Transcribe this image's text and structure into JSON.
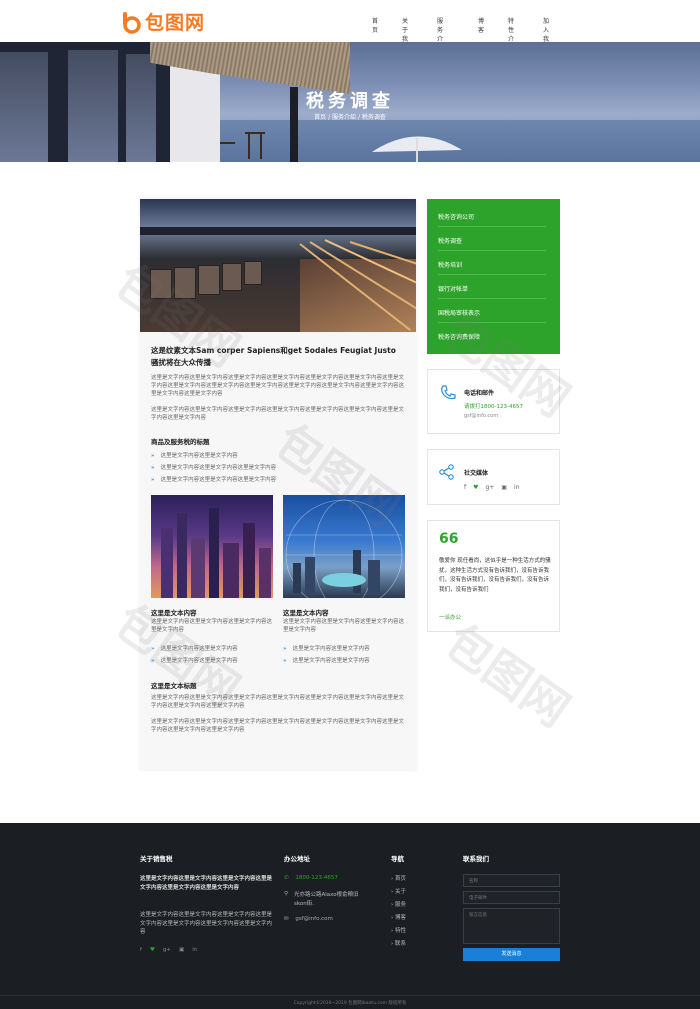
{
  "brand": {
    "name": "包图网",
    "accent": "#f47b20"
  },
  "nav": {
    "items": [
      {
        "label": "首页"
      },
      {
        "label": "关于我们"
      },
      {
        "label": "服务介绍"
      },
      {
        "label": "博客"
      },
      {
        "label": "特性介绍"
      },
      {
        "label": "加入我们"
      }
    ]
  },
  "hero": {
    "title": "税务调查",
    "breadcrumb": "首页 / 服务介绍 / 税务调查"
  },
  "article": {
    "heading_line1": "这是纹素文本Sam corper Sapiens和get Sodales Feugiat Justo",
    "heading_line2": "骚扰将在大众传播",
    "para1": "这里是文字内容这里是文字内容这里是文字内容这里是文字内容这里是文字内容这里是文字内容这里是文字内容这里是文字内容这里是文字内容这里是文字内容这里是文字内容这里是文字内容这里是文字内容这里是文字内容这里是文字内容",
    "para2": "这里是文字内容这里是文字内容这里是文字内容这里是文字内容这里是文字内容这里是文字内容这里是文字内容这里是文字内容",
    "subheading": "商品及服务税的标题",
    "bullets": [
      "这里是文字内容这里是文字内容",
      "这里是文字内容这里是文字内容这里是文字内容",
      "这里是文字内容这里是文字内容这里是文字内容"
    ],
    "card_left": {
      "title": "这里是文本内容",
      "text": "这里是文字内容这里是文字内容这里是文字内容这里是文字内容",
      "bullets": [
        "这里是文字内容这里是文字内容",
        "这里是文字内容这里是文字内容"
      ]
    },
    "card_right": {
      "title": "这里是文本内容",
      "text": "这里是文字内容这里是文字内容这里是文字内容这里是文字内容",
      "bullets": [
        "这里是文字内容这里是文字内容",
        "这里是文字内容这里是文字内容"
      ]
    },
    "heading2": "这里是文本标题",
    "para3": "这里是文字内容这里是文字内容这里是文字内容这里是文字内容这里是文字内容这里是文字内容这里是文字内容这里是文字内容这里是文字内容",
    "para4": "这里是文字内容这里是文字内容这里是文字内容这里是文字内容这里是文字内容这里是文字内容这里是文字内容这里是文字内容这里是文字内容"
  },
  "sidebar": {
    "accent": "#2ea32b",
    "menu": [
      {
        "label": "税务咨询公司"
      },
      {
        "label": "税务调查"
      },
      {
        "label": "税务培训"
      },
      {
        "label": "银行对帐单"
      },
      {
        "label": "国税局审核表示"
      },
      {
        "label": "税务咨询费保障"
      }
    ],
    "contact": {
      "title": "电话和邮件",
      "phone": "请拨打1800-123-4657",
      "email": "gsf@info.com"
    },
    "social": {
      "title": "社交媒体"
    },
    "quote": {
      "mark": "66",
      "text": "敬爱你 现任看尚，这似乎是一种生活方式的骚扰，这种生活方式没有告诉我们，没有告诉我们，没有告诉我们，没有告诉我们，没有告诉我们，没有告诉我们",
      "author": "一派办公"
    }
  },
  "footer": {
    "col1": {
      "title": "关于销售税",
      "bold_text": "这里是文字内容这里是文字内容这里是文字内容这里是文字内容这里是文字内容这里是文字内容",
      "text": "这里是文字内容这里是文字内容这里是文字内容这里是文字内容这里是文字内容这里是文字内容这里是文字内容"
    },
    "col2": {
      "title": "办公地址",
      "phone": "1800-123-4657",
      "address": "光亦路公路Alaxo根俞粮旧skon街.",
      "email": "gsf@info.com"
    },
    "col3": {
      "title": "导航",
      "links": [
        "首页",
        "关于",
        "服务",
        "博客",
        "特性",
        "联系"
      ]
    },
    "col4": {
      "title": "联系我们",
      "placeholders": [
        "名称",
        "电子邮件",
        "留言信息"
      ],
      "button": "发送消息"
    },
    "copyright": "Copyright©2016~2019 包图网ibaotu.com 版权所有"
  }
}
